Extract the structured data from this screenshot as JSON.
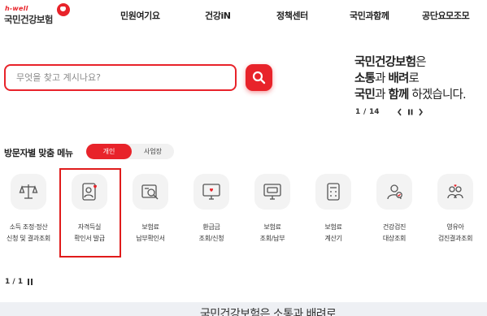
{
  "header": {
    "logo": {
      "tagline": "h-well",
      "name": "국민건강보험"
    },
    "nav": [
      "민원여기요",
      "건강iN",
      "정책센터",
      "국민과함께",
      "공단요모조모"
    ]
  },
  "search": {
    "placeholder": "무엇을 찾고 계시나요?",
    "value": ""
  },
  "slogan": {
    "line1": {
      "bold": "국민건강보험",
      "normal": "은"
    },
    "line2": {
      "bold1": "소통",
      "normal1": "과 ",
      "bold2": "배려",
      "normal2": "로"
    },
    "line3": {
      "bold1": "국민",
      "normal1": "과 ",
      "bold2": "함께",
      "normal2": " 하겠습니다."
    }
  },
  "slider": {
    "current": "1",
    "separator": "/",
    "total": "14"
  },
  "menu": {
    "title": "방문자별 맞춤 메뉴",
    "toggle": {
      "active": "개인",
      "inactive": "사업장"
    }
  },
  "services": [
    {
      "icon": "scale-icon",
      "line1": "소득 조정·정산",
      "line2": "신청 및 결과조회"
    },
    {
      "icon": "id-card-heart-icon",
      "line1": "자격득실",
      "line2": "확인서 발급"
    },
    {
      "icon": "doc-search-icon",
      "line1": "보험료",
      "line2": "납부확인서"
    },
    {
      "icon": "monitor-heart-icon",
      "line1": "환급금",
      "line2": "조회/신청"
    },
    {
      "icon": "monitor-card-icon",
      "line1": "보험료",
      "line2": "조회/납부"
    },
    {
      "icon": "calculator-icon",
      "line1": "보험료",
      "line2": "계산기"
    },
    {
      "icon": "person-check-icon",
      "line1": "건강검진",
      "line2": "대상조회"
    },
    {
      "icon": "family-icon",
      "line1": "영유아",
      "line2": "검진결과조회"
    }
  ],
  "pager": {
    "text": "1 / 1"
  },
  "bottom_banner": {
    "text": "국민건강보험은 소통과 배려로"
  },
  "colors": {
    "brand": "#e8232a",
    "tile_bg": "#f3f3f3",
    "highlight": "#e01b1b"
  }
}
